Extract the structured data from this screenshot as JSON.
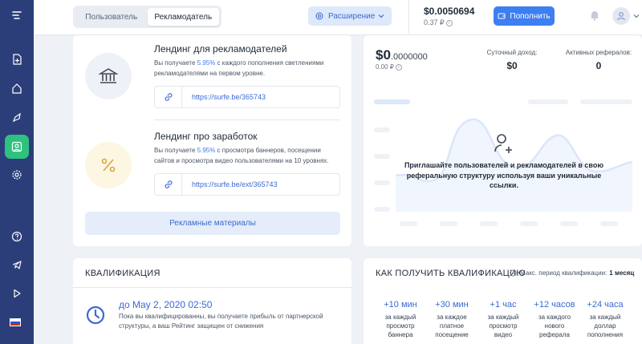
{
  "sidebar": {
    "items": [
      {
        "icon": "menu-icon"
      },
      {
        "icon": "add-document-icon"
      },
      {
        "icon": "home-icon"
      },
      {
        "icon": "rocket-icon"
      },
      {
        "icon": "referrals-icon",
        "active": true
      },
      {
        "icon": "gear-icon"
      },
      {
        "icon": "help-icon"
      },
      {
        "icon": "telegram-icon"
      },
      {
        "icon": "play-icon"
      }
    ],
    "language_flag": "russia-flag"
  },
  "header": {
    "role_tabs": [
      "Пользователь",
      "Рекламодатель"
    ],
    "active_role": "Рекламодатель",
    "extension_label": "Расширение",
    "balance": "$0.0050694",
    "balance_rub": "0.37 ₽",
    "topup_label": "Пополнить"
  },
  "landing_advertisers": {
    "title": "Лендинг для рекламодателей",
    "desc_prefix": "Вы получаете ",
    "desc_percent": "5.95%",
    "desc_suffix": " с каждого пополнения светлениями рекламодателями на первом уровне.",
    "url": "https://surfe.be/365743"
  },
  "landing_earnings": {
    "title": "Лендинг про заработок",
    "desc_prefix": "Вы получаете ",
    "desc_percent": "5.95%",
    "desc_suffix": " с просмотра баннеров, посещении сайтов и просмотра видео пользователями на 10 уровнях.",
    "url": "https://surfe.be/ext/365743"
  },
  "promo_button": "Рекламные материалы",
  "stats": {
    "amount_main": "$0",
    "amount_decimals": ".0000000",
    "amount_rub": "0.00 ₽",
    "daily_income_label": "Суточный доход:",
    "daily_income_value": "$0",
    "active_referrals_label": "Активных рефералов:",
    "active_referrals_value": "0",
    "invite_text": "Приглашайте пользователей и рекламодателей в свою реферальную структуру используя ваши уникальные ссылки."
  },
  "qualification": {
    "title": "КВАЛИФИКАЦИЯ",
    "date": "до May 2, 2020 02:50",
    "text": "Пока вы квалифицированны, вы получаете прибыль от партнерской структуры, а ваш Рейтинг защищен от снижения"
  },
  "how_to": {
    "title": "КАК ПОЛУЧИТЬ КВАЛИФИКАЦИЮ",
    "period_label": "Макс. период квалификации:",
    "period_value": "1 месяц",
    "perks": [
      {
        "value": "+10 мин",
        "desc": "за каждый просмотр баннера"
      },
      {
        "value": "+30 мин",
        "desc": "за каждое платное посещение"
      },
      {
        "value": "+1 час",
        "desc": "за каждый просмотр видео"
      },
      {
        "value": "+12 часов",
        "desc": "за каждого нового реферала"
      },
      {
        "value": "+24 часа",
        "desc": "за каждый доллар пополнения"
      }
    ]
  },
  "colors": {
    "sidebar": "#2c3e7a",
    "accent": "#3d7ef0",
    "active_green": "#2ec27e"
  }
}
